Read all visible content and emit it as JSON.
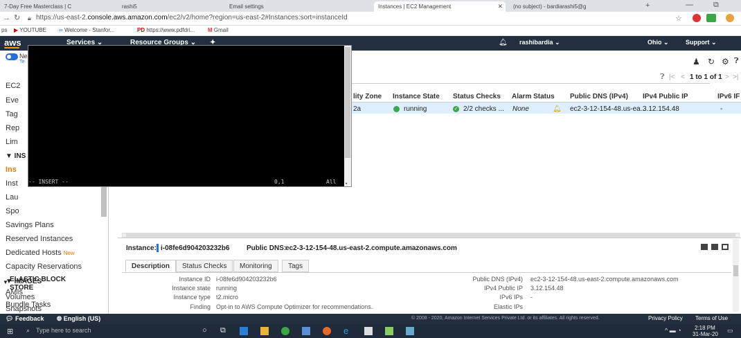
{
  "browser": {
    "tabs": [
      {
        "label": "7-Day Free Masterclass | C"
      },
      {
        "label": "rashi5"
      },
      {
        "label": "Email settings"
      },
      {
        "label": "Instances | EC2 Management"
      },
      {
        "label": "(no subject) - bardiarashi5@g"
      }
    ],
    "url_prefix": "https://us-east-2.",
    "url_host": "console.aws.amazon.com",
    "url_path": "/ec2/v2/home?region=us-east-2#Instances:sort=instanceId",
    "bookmarks": [
      {
        "label": "ps"
      },
      {
        "label": "YOUTUBE"
      },
      {
        "label": "Welcome - Stanfor..."
      },
      {
        "label": "https://www.pdfdri..."
      },
      {
        "label": "Gmail"
      }
    ]
  },
  "awsnav": {
    "logo": "aws",
    "services": "Services ⌄",
    "resource_groups": "Resource Groups ⌄",
    "user": "rashibardia ⌄",
    "region": "Ohio ⌄",
    "support": "Support ⌄"
  },
  "sidebar": {
    "items": [
      {
        "label": "EC2"
      },
      {
        "label": "Eve"
      },
      {
        "label": "Tag"
      },
      {
        "label": "Rep"
      },
      {
        "label": "Lim"
      },
      {
        "label": "▼ INS"
      },
      {
        "label": "Ins"
      },
      {
        "label": "Inst"
      },
      {
        "label": "Lau"
      },
      {
        "label": "Spo"
      },
      {
        "label": "Savings Plans"
      },
      {
        "label": "Reserved Instances"
      },
      {
        "label": "Dedicated Hosts"
      },
      {
        "label": "Capacity Reservations"
      },
      {
        "label": "▼ IMAGES"
      },
      {
        "label": "AMIs"
      },
      {
        "label": "Bundle Tasks"
      },
      {
        "label": "ELASTIC BLOCK"
      },
      {
        "label": "STORE"
      },
      {
        "label": "Volumes"
      },
      {
        "label": "Snapshots"
      }
    ],
    "new_badge": "New",
    "toggle_label": "Ne",
    "toggle_sub": "Te"
  },
  "terminal": {
    "status_mode": "-- INSERT --",
    "status_pos": "0,1",
    "status_all": "All"
  },
  "table": {
    "pagination": "1 to 1 of 1",
    "headers": [
      "lity Zone",
      "Instance State",
      "Status Checks",
      "Alarm Status",
      "Public DNS (IPv4)",
      "IPv4 Public IP",
      "IPv6 IF"
    ],
    "row": {
      "zone": "2a",
      "state": "running",
      "checks": "2/2 checks ...",
      "alarm": "None",
      "dns": "ec2-3-12-154-48.us-ea...",
      "ip": "3.12.154.48",
      "ipv6": "-"
    }
  },
  "details": {
    "instance_label": "Instance:",
    "instance_id": "i-08fe6d904203232b6",
    "public_dns_label": "Public DNS:",
    "public_dns": "ec2-3-12-154-48.us-east-2.compute.amazonaws.com",
    "tabs": [
      "Description",
      "Status Checks",
      "Monitoring",
      "Tags"
    ],
    "left_fields": [
      {
        "label": "Instance ID",
        "value": "i-08fe6d904203232b6"
      },
      {
        "label": "Instance state",
        "value": "running"
      },
      {
        "label": "Instance type",
        "value": "t2.micro"
      },
      {
        "label": "Finding",
        "value": "Opt-in to AWS Compute Optimizer for recommendations."
      }
    ],
    "right_fields": [
      {
        "label": "Public DNS (IPv4)",
        "value": "ec2-3-12-154-48.us-east-2.compute.amazonaws.com"
      },
      {
        "label": "IPv4 Public IP",
        "value": "3.12.154.48"
      },
      {
        "label": "IPv6 IPs",
        "value": "-"
      },
      {
        "label": "Elastic IPs",
        "value": ""
      }
    ]
  },
  "footer": {
    "feedback": "Feedback",
    "language": "English (US)",
    "copyright": "© 2008 - 2020, Amazon Internet Services Private Ltd. or its affiliates. All rights reserved.",
    "privacy": "Privacy Policy",
    "terms": "Terms of Use"
  },
  "taskbar": {
    "search_placeholder": "Type here to search",
    "time": "2:18 PM",
    "date": "31-Mar-20"
  },
  "colors": {
    "aws_nav": "#232f3e",
    "accent_orange": "#e07b00",
    "running_green": "#3aa845",
    "selected_row": "#deeefc"
  }
}
